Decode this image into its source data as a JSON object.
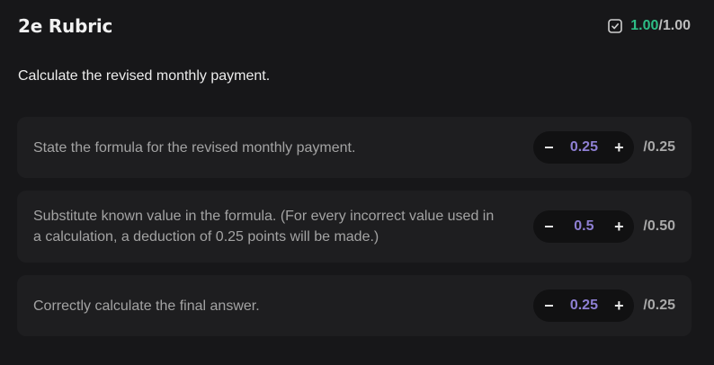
{
  "header": {
    "title": "2e Rubric",
    "score_earned": "1.00",
    "score_total": "/1.00",
    "check_icon": "checkbox-checked-icon",
    "accent_color": "#2dbd85"
  },
  "prompt": "Calculate the revised monthly payment.",
  "criteria": [
    {
      "text": "State the formula for the revised monthly payment.",
      "minus": "−",
      "value": "0.25",
      "plus": "+",
      "max": "/0.25"
    },
    {
      "text": "Substitute known value in the formula. (For every incorrect value used in a calculation, a deduction of 0.25 points will be made.)",
      "minus": "−",
      "value": "0.5",
      "plus": "+",
      "max": "/0.50"
    },
    {
      "text": "Correctly calculate the final answer.",
      "minus": "−",
      "value": "0.25",
      "plus": "+",
      "max": "/0.25"
    }
  ],
  "colors": {
    "value": "#8e7fd3",
    "background": "#171719",
    "card": "#1e1e20"
  }
}
